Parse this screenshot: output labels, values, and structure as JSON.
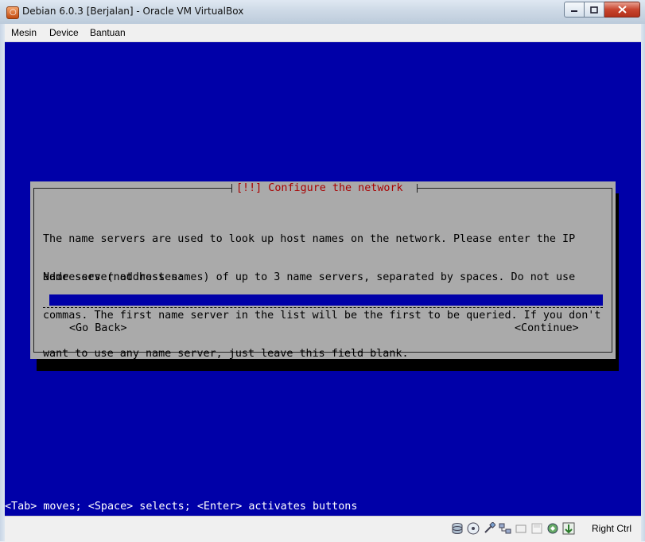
{
  "window": {
    "title": "Debian 6.0.3 [Berjalan] - Oracle VM VirtualBox",
    "app_icon": "virtualbox-icon"
  },
  "menu": {
    "items": [
      "Mesin",
      "Device",
      "Bantuan"
    ]
  },
  "dialog": {
    "title": "[!!] Configure the network",
    "body_lines": [
      "The name servers are used to look up host names on the network. Please enter the IP",
      "addresses (not host names) of up to 3 name servers, separated by spaces. Do not use",
      "commas. The first name server in the list will be the first to be queried. If you don't",
      "want to use any name server, just leave this field blank."
    ],
    "field_label": "Name server addresses:",
    "field_value": "",
    "back_button": "<Go Back>",
    "continue_button": "<Continue>"
  },
  "hint": "<Tab> moves; <Space> selects; <Enter> activates buttons",
  "statusbar": {
    "icons": [
      "hard-disk-icon",
      "optical-drive-icon",
      "usb-icon",
      "network-icon",
      "shared-folder-icon",
      "floppy-icon",
      "display-icon",
      "capture-icon",
      "mouse-integration-icon"
    ],
    "host_key": "Right Ctrl"
  },
  "colors": {
    "screen_bg": "#0000a8",
    "dialog_bg": "#aaaaaa",
    "dialog_title": "#a80000"
  }
}
